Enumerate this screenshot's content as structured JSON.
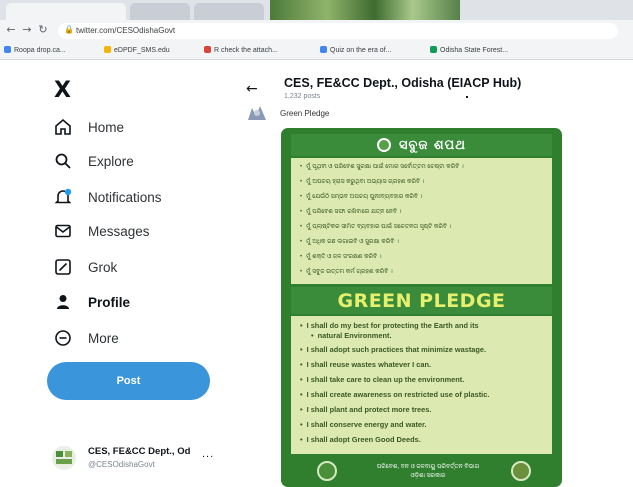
{
  "browser": {
    "url": "twitter.com/CESOdishaGovt",
    "bookmarks": [
      {
        "label": "Roopa drop.ca...",
        "color": "#4285f4"
      },
      {
        "label": "eDPDF_SMS.edu",
        "color": "#f4b400"
      },
      {
        "label": "R check the attach...",
        "color": "#db4437"
      },
      {
        "label": "Quiz on the era of...",
        "color": "#4285f4"
      },
      {
        "label": "Odisha State Forest...",
        "color": "#0f9d58"
      }
    ]
  },
  "sidebar": {
    "logo": "X",
    "items": [
      {
        "label": "Home",
        "icon": "home-icon",
        "active": false
      },
      {
        "label": "Explore",
        "icon": "search-icon",
        "active": false
      },
      {
        "label": "Notifications",
        "icon": "bell-icon",
        "active": false
      },
      {
        "label": "Messages",
        "icon": "mail-icon",
        "active": false
      },
      {
        "label": "Grok",
        "icon": "grok-icon",
        "active": false
      },
      {
        "label": "Profile",
        "icon": "person-icon",
        "active": true
      },
      {
        "label": "More",
        "icon": "more-circle-icon",
        "active": false
      }
    ],
    "post_label": "Post",
    "account": {
      "name": "CES, FE&CC Dept., Od",
      "handle": "@CESOdishaGovt",
      "more": "..."
    }
  },
  "header": {
    "back": "←",
    "name": "CES, FE&CC Dept., Odisha (EIACP Hub)",
    "posts": "1,232 posts"
  },
  "tweet": {
    "text": "Green Pledge"
  },
  "poster": {
    "odia_title": "ସବୁଜ ଶପଥ",
    "odia_lines": [
      "ମୁଁ ପୃଥିବୀ ଓ ପରିବେଶ ସୁରକ୍ଷା ପାଇଁ ମୋର ସର୍ବୋତ୍ତମ ଚେଷ୍ଟା କରିବି ।",
      "ମୁଁ ଅପଚୟ ହ୍ରାସ କରୁଥିବା ଅଭ୍ୟାସ ଗ୍ରହଣ କରିବି ।",
      "ମୁଁ ଯେଉଁଠି ସମ୍ଭବ ଅପଚୟ ପୁନଃବ୍ୟବହାର କରିବି ।",
      "ମୁଁ ପରିବେଶ ସଫା ରଖିବାରେ ଯତ୍ନ ନେବି ।",
      "ମୁଁ ପ୍ଲାଷ୍ଟିକର ସୀମିତ ବ୍ୟବହାର ପାଇଁ ସଚେତନତା ସୃଷ୍ଟି କରିବି ।",
      "ମୁଁ ଅଧିକ ଗଛ ଲଗାଇବି ଓ ସୁରକ୍ଷା କରିବି ।",
      "ମୁଁ ଶକ୍ତି ଓ ଜଳ ସଂରକ୍ଷଣ କରିବି ।",
      "ମୁଁ ସବୁଜ ଉତ୍ତମ କର୍ମ ଗ୍ରହଣ କରିବି ।"
    ],
    "english_title": "GREEN PLEDGE",
    "english_lines": [
      "I shall do my best for protecting the Earth and its",
      "natural Environment.",
      "I shall adopt such practices that minimize wastage.",
      "I shall reuse wastes whatever I can.",
      "I shall take care to clean up the environment.",
      "I shall create awareness on restricted use of plastic.",
      "I shall plant and protect more trees.",
      "I shall conserve energy and water.",
      "I shall adopt Green Good Deeds."
    ],
    "bottom_text_1": "ପରିବେଶ, ବନ ଓ ଜଳବାୟୁ ପରିବର୍ତ୍ତନ ବିଭାଗ",
    "bottom_text_2": "ଓଡ଼ିଶା ସରକାର"
  },
  "colors": {
    "poster_green": "#2f7f2f",
    "panel": "#dceab2",
    "pledge_yellow": "#e6ef6e",
    "post_button": "#3b95db"
  }
}
